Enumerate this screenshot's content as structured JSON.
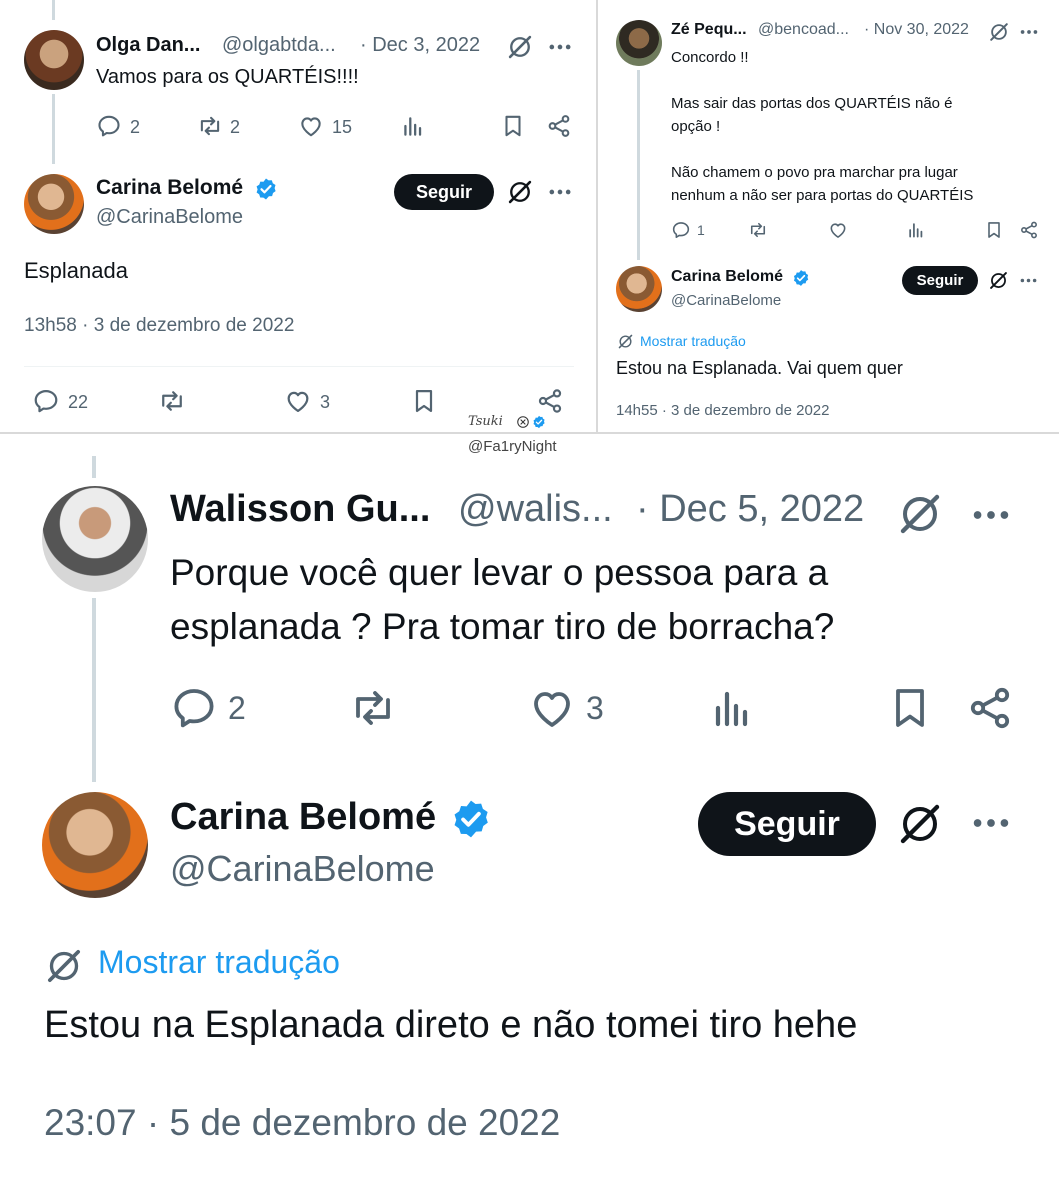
{
  "colors": {
    "accent": "#1d9bf0",
    "text": "#0f1419",
    "muted": "#536471",
    "button": "#0f1419"
  },
  "panel_top_left": {
    "reply_tweet": {
      "name": "Olga Dan...",
      "handle": "@olgabtda...",
      "date": "· Dec 3, 2022",
      "text": "Vamos para os QUARTÉIS!!!!",
      "replies": "2",
      "reposts": "2",
      "likes": "15"
    },
    "main_tweet": {
      "name": "Carina Belomé",
      "handle": "@CarinaBelome",
      "follow_label": "Seguir",
      "text": "Esplanada",
      "timestamp": "13h58 · 3 de dezembro de 2022",
      "replies": "22",
      "likes": "3"
    }
  },
  "panel_top_right": {
    "reply_tweet": {
      "name": "Zé Pequ...",
      "handle": "@bencoad...",
      "date": "· Nov 30, 2022",
      "text": "Concordo !!\n\nMas  sair  das portas dos QUARTÉIS não é\nopção !\n\nNão chamem o povo pra marchar pra lugar\nnenhum a não ser para portas do QUARTÉIS",
      "replies": "1"
    },
    "main_tweet": {
      "name": "Carina Belomé",
      "handle": "@CarinaBelome",
      "follow_label": "Seguir",
      "translate_label": "Mostrar tradução",
      "text": "Estou na Esplanada. Vai quem quer",
      "timestamp": "14h55 · 3 de dezembro de 2022"
    }
  },
  "watermark": {
    "line1": "Tsuki",
    "line2": "@Fa1ryNight"
  },
  "panel_bottom": {
    "reply_tweet": {
      "name": "Walisson Gu...",
      "handle": "@walis...",
      "date": "· Dec 5, 2022",
      "text": "Porque você quer levar o pessoa para a\nesplanada ? Pra tomar tiro de borracha?",
      "replies": "2",
      "likes": "3"
    },
    "main_tweet": {
      "name": "Carina Belomé",
      "handle": "@CarinaBelome",
      "follow_label": "Seguir",
      "translate_label": "Mostrar tradução",
      "text": "Estou na Esplanada direto e não tomei tiro hehe",
      "timestamp": "23:07 · 5 de dezembro de 2022"
    }
  },
  "icons": [
    "reply-icon",
    "repost-icon",
    "like-icon",
    "views-icon",
    "bookmark-icon",
    "share-icon",
    "grok-icon",
    "more-icon",
    "verified-badge-icon",
    "translate-icon"
  ]
}
